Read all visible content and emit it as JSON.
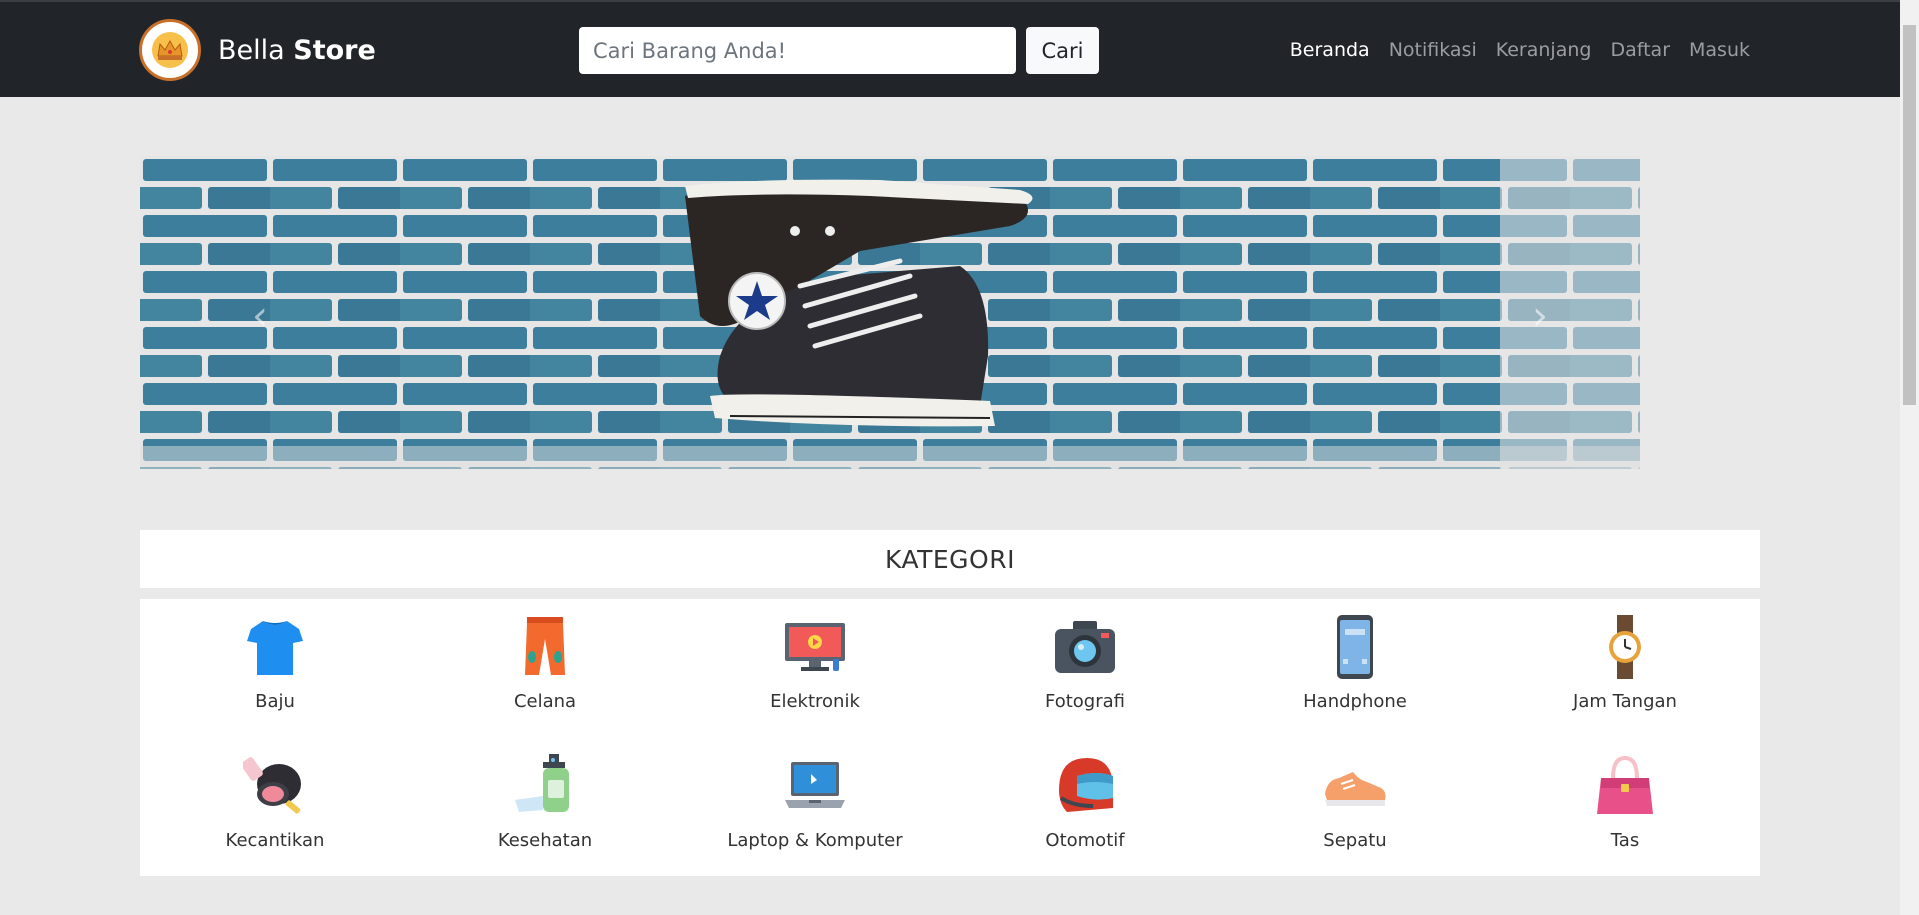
{
  "brand": {
    "name_regular": "Bella",
    "name_bold": "Store",
    "logo_icon": "crown-icon"
  },
  "search": {
    "placeholder": "Cari Barang Anda!",
    "value": "",
    "button_label": "Cari"
  },
  "nav": {
    "links": [
      {
        "label": "Beranda",
        "active": true
      },
      {
        "label": "Notifikasi",
        "active": false
      },
      {
        "label": "Keranjang",
        "active": false
      },
      {
        "label": "Daftar",
        "active": false
      },
      {
        "label": "Masuk",
        "active": false
      }
    ]
  },
  "carousel": {
    "prev_icon": "chevron-left-icon",
    "next_icon": "chevron-right-icon",
    "slide_image": "converse-sneakers-brick-wall",
    "shoe_patch_text": "ALL STAR"
  },
  "categories": {
    "title": "KATEGORI",
    "items": [
      {
        "label": "Baju",
        "icon": "tshirt-icon"
      },
      {
        "label": "Celana",
        "icon": "pants-icon"
      },
      {
        "label": "Elektronik",
        "icon": "monitor-icon"
      },
      {
        "label": "Fotografi",
        "icon": "camera-icon"
      },
      {
        "label": "Handphone",
        "icon": "smartphone-icon"
      },
      {
        "label": "Jam Tangan",
        "icon": "wristwatch-icon"
      },
      {
        "label": "Kecantikan",
        "icon": "makeup-compact-icon"
      },
      {
        "label": "Kesehatan",
        "icon": "hand-sanitizer-icon"
      },
      {
        "label": "Laptop & Komputer",
        "icon": "laptop-icon"
      },
      {
        "label": "Otomotif",
        "icon": "helmet-icon"
      },
      {
        "label": "Sepatu",
        "icon": "sneaker-icon"
      },
      {
        "label": "Tas",
        "icon": "handbag-icon"
      }
    ]
  },
  "colors": {
    "navbar_bg": "#212529",
    "page_bg": "#e9e9e9",
    "nav_active": "#ffffff",
    "nav_inactive": "#9a9da1"
  }
}
